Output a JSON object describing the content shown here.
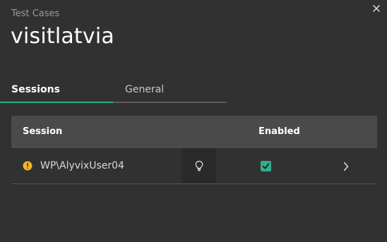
{
  "header": {
    "breadcrumb": "Test Cases",
    "title": "visitlatvia"
  },
  "tabs": [
    {
      "label": "Sessions",
      "active": true
    },
    {
      "label": "General",
      "active": false
    }
  ],
  "table": {
    "columns": {
      "session": "Session",
      "enabled": "Enabled"
    },
    "rows": [
      {
        "status_icon": "warning-icon",
        "session": "WP\\AlyvixUser04",
        "hint_icon": "lightbulb-icon",
        "enabled": true,
        "action_icon": "chevron-right-icon"
      }
    ]
  },
  "colors": {
    "background": "#313131",
    "header_bg": "#4a4a4a",
    "accent": "#2fae8f",
    "warning": "#f0b428"
  }
}
